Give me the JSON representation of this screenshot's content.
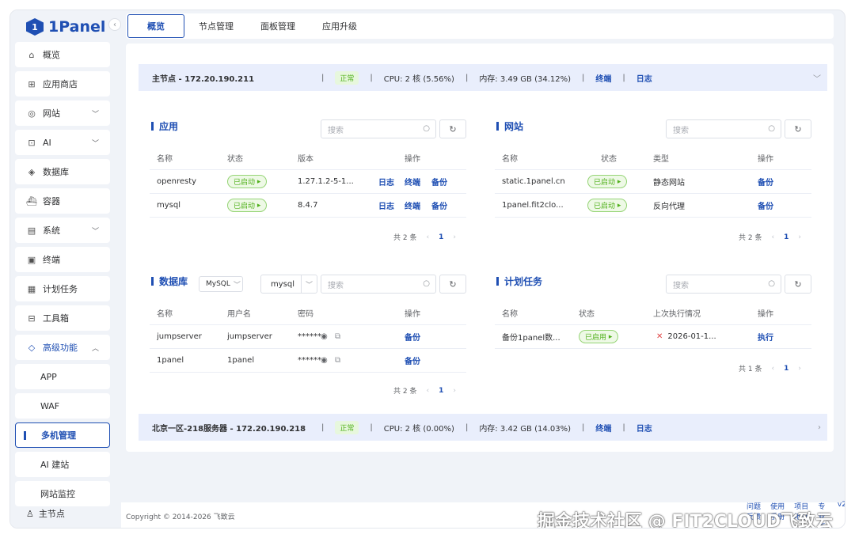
{
  "app": {
    "logo_text": "1Panel",
    "logo_mark": "1"
  },
  "sidebar": {
    "items": [
      {
        "label": "概览",
        "icon": "home-icon"
      },
      {
        "label": "应用商店",
        "icon": "grid-icon"
      },
      {
        "label": "网站",
        "icon": "globe-icon"
      },
      {
        "label": "AI",
        "icon": "robot-icon"
      },
      {
        "label": "数据库",
        "icon": "database-icon"
      },
      {
        "label": "容器",
        "icon": "docker-icon"
      },
      {
        "label": "系统",
        "icon": "system-icon"
      },
      {
        "label": "终端",
        "icon": "terminal-icon"
      },
      {
        "label": "计划任务",
        "icon": "calendar-icon"
      },
      {
        "label": "工具箱",
        "icon": "toolbox-icon"
      },
      {
        "label": "高级功能",
        "icon": "diamond-icon"
      }
    ],
    "sub_items": [
      "APP",
      "WAF",
      "多机管理",
      "AI 建站",
      "网站监控"
    ],
    "bottom_node": "主节点"
  },
  "tabs": [
    "概览",
    "节点管理",
    "面板管理",
    "应用升级"
  ],
  "node1": {
    "name": "主节点 - 172.20.190.211",
    "status": "正常",
    "cpu": "CPU: 2 核 (5.56%)",
    "mem": "内存: 3.49 GB (34.12%)",
    "terminal": "终端",
    "log": "日志",
    "sep": "|"
  },
  "node2": {
    "name": "北京一区-218服务器 - 172.20.190.218",
    "status": "正常",
    "cpu": "CPU: 2 核 (0.00%)",
    "mem": "内存: 3.42 GB (14.03%)",
    "terminal": "终端",
    "log": "日志",
    "sep": "|"
  },
  "apps": {
    "title": "应用",
    "search_placeholder": "搜索",
    "headers": [
      "名称",
      "状态",
      "版本",
      "操作"
    ],
    "rows": [
      {
        "name": "openresty",
        "status": "已启动",
        "version": "1.27.1.2-5-1...",
        "a1": "日志",
        "a2": "终端",
        "a3": "备份"
      },
      {
        "name": "mysql",
        "status": "已启动",
        "version": "8.4.7",
        "a1": "日志",
        "a2": "终端",
        "a3": "备份"
      }
    ],
    "total": "共 2 条",
    "page": "1"
  },
  "sites": {
    "title": "网站",
    "search_placeholder": "搜索",
    "headers": [
      "名称",
      "状态",
      "类型",
      "操作"
    ],
    "rows": [
      {
        "name": "static.1panel.cn",
        "status": "已启动",
        "type": "静态网站",
        "a1": "备份"
      },
      {
        "name": "1panel.fit2clo...",
        "status": "已启动",
        "type": "反向代理",
        "a1": "备份"
      }
    ],
    "total": "共 2 条",
    "page": "1"
  },
  "db": {
    "title": "数据库",
    "type_select": "MySQL",
    "db_select": "mysql",
    "search_placeholder": "搜索",
    "headers": [
      "名称",
      "用户名",
      "密码",
      "操作"
    ],
    "rows": [
      {
        "name": "jumpserver",
        "user": "jumpserver",
        "password": "******",
        "a1": "备份"
      },
      {
        "name": "1panel",
        "user": "1panel",
        "password": "******",
        "a1": "备份"
      }
    ],
    "total": "共 2 条",
    "page": "1"
  },
  "cron": {
    "title": "计划任务",
    "search_placeholder": "搜索",
    "headers": [
      "名称",
      "状态",
      "上次执行情况",
      "操作"
    ],
    "rows": [
      {
        "name": "备份1panel数...",
        "status": "已启用",
        "last": "2026-01-1...",
        "a1": "执行"
      }
    ],
    "total": "共 1 条",
    "page": "1"
  },
  "footer": {
    "copyright": "Copyright © 2014-2026 飞致云",
    "links": [
      "问题反馈",
      "使用手册",
      "项目地址",
      "专业版",
      "v2"
    ]
  },
  "watermark": "掘金技术社区 @ FIT2CLOUD飞致云",
  "colors": {
    "accent": "#1f4fb3",
    "running": "#52b11d",
    "bg": "#f0f3f8"
  }
}
